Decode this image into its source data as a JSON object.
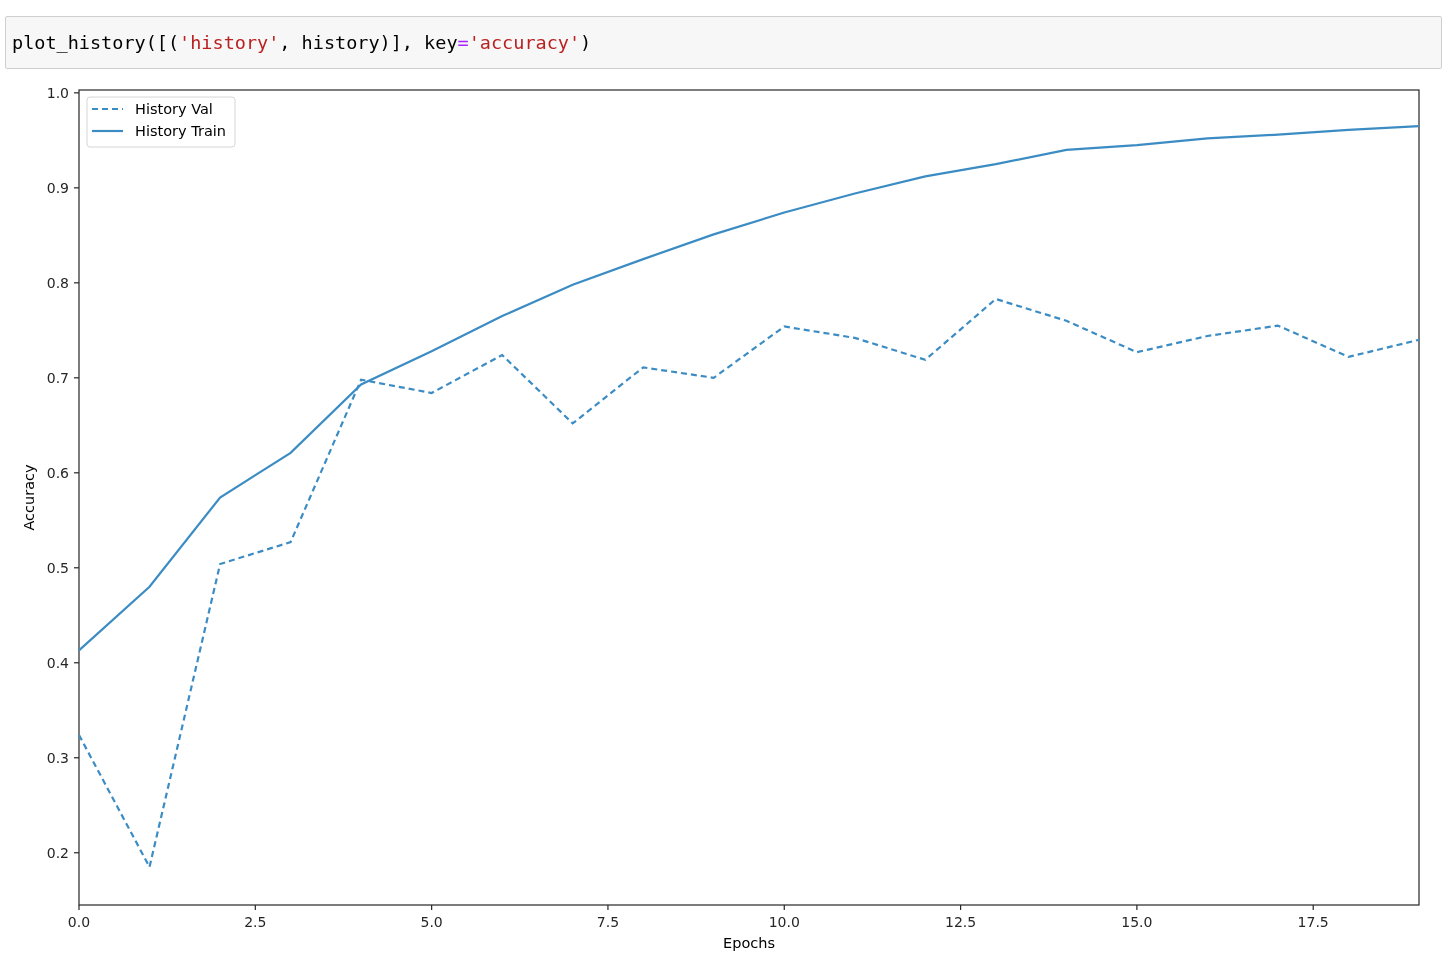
{
  "code_cell": {
    "tokens": [
      {
        "text": "plot_history([(",
        "kind": "plain"
      },
      {
        "text": "'history'",
        "kind": "string"
      },
      {
        "text": ", history)], key",
        "kind": "plain"
      },
      {
        "text": "=",
        "kind": "operator"
      },
      {
        "text": "'accuracy'",
        "kind": "string"
      },
      {
        "text": ")",
        "kind": "plain"
      }
    ]
  },
  "output": {
    "chart_data": {
      "type": "line",
      "xlabel": "Epochs",
      "ylabel": "Accuracy",
      "x": [
        0,
        1,
        2,
        3,
        4,
        5,
        6,
        7,
        8,
        9,
        10,
        11,
        12,
        13,
        14,
        15,
        16,
        17,
        18,
        19
      ],
      "series": [
        {
          "name": "History Val",
          "color": "#3c8cc4",
          "line_style": "dashed",
          "values": [
            0.324,
            0.185,
            0.504,
            0.527,
            0.698,
            0.684,
            0.724,
            0.652,
            0.711,
            0.7,
            0.754,
            0.742,
            0.719,
            0.783,
            0.76,
            0.727,
            0.744,
            0.755,
            0.722,
            0.74
          ]
        },
        {
          "name": "History Train",
          "color": "#3c8cc4",
          "line_style": "solid",
          "values": [
            0.413,
            0.48,
            0.574,
            0.621,
            0.693,
            0.728,
            0.765,
            0.798,
            0.825,
            0.851,
            0.874,
            0.894,
            0.912,
            0.925,
            0.94,
            0.945,
            0.952,
            0.956,
            0.961,
            0.965
          ]
        }
      ],
      "legend": true,
      "xlim": [
        0,
        19
      ],
      "ylim": [
        0.145,
        1.003
      ],
      "xticks": [
        {
          "value": 0,
          "label": "0.0"
        },
        {
          "value": 2.5,
          "label": "2.5"
        },
        {
          "value": 5,
          "label": "5.0"
        },
        {
          "value": 7.5,
          "label": "7.5"
        },
        {
          "value": 10,
          "label": "10.0"
        },
        {
          "value": 12.5,
          "label": "12.5"
        },
        {
          "value": 15,
          "label": "15.0"
        },
        {
          "value": 17.5,
          "label": "17.5"
        }
      ],
      "yticks": [
        {
          "value": 0.2,
          "label": "0.2"
        },
        {
          "value": 0.3,
          "label": "0.3"
        },
        {
          "value": 0.4,
          "label": "0.4"
        },
        {
          "value": 0.5,
          "label": "0.5"
        },
        {
          "value": 0.6,
          "label": "0.6"
        },
        {
          "value": 0.7,
          "label": "0.7"
        },
        {
          "value": 0.8,
          "label": "0.8"
        },
        {
          "value": 0.9,
          "label": "0.9"
        },
        {
          "value": 1.0,
          "label": "1.0"
        }
      ]
    }
  }
}
